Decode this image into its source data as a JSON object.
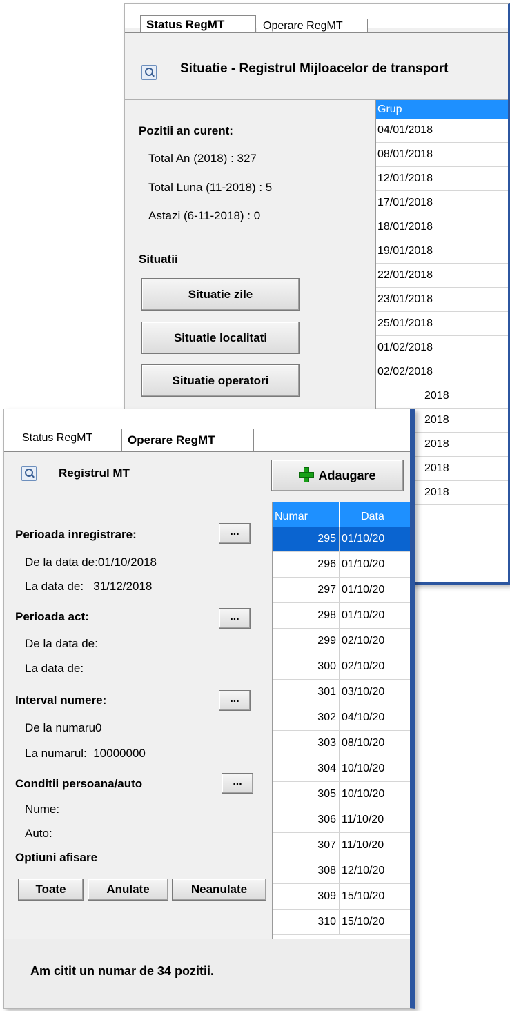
{
  "back_window": {
    "tabs": [
      "Status RegMT",
      "Operare RegMT"
    ],
    "title": "Situatie - Registrul Mijloacelor de transport",
    "section_positions": "Pozitii an curent:",
    "total_an": "Total An (2018) : 327",
    "total_luna": "Total Luna (11-2018) : 5",
    "astazi": "Astazi (6-11-2018) : 0",
    "section_reports": "Situatii",
    "btn_zile": "Situatie zile",
    "btn_localitati": "Situatie localitati",
    "btn_operatori": "Situatie operatori",
    "grid_header": "Grup",
    "grid_rows": [
      "04/01/2018",
      "08/01/2018",
      "12/01/2018",
      "17/01/2018",
      "18/01/2018",
      "19/01/2018",
      "22/01/2018",
      "23/01/2018",
      "25/01/2018",
      "01/02/2018",
      "02/02/2018",
      "2018",
      "2018",
      "2018",
      "2018",
      "2018"
    ]
  },
  "front_window": {
    "tabs": [
      "Status RegMT",
      "Operare RegMT"
    ],
    "title": "Registrul MT",
    "add_button": "Adaugare",
    "perioada_inregistrare": "Perioada inregistrare:",
    "de_la_data_1": "De la data de:01/10/2018",
    "la_data_1": "La data de:   31/12/2018",
    "perioada_act": "Perioada act:",
    "de_la_data_2": "De la data de:",
    "la_data_2": "La data de:",
    "interval_numere": "Interval numere:",
    "de_la_numar": "De la numaru0",
    "la_numar": "La numarul:  10000000",
    "conditii": "Conditii persoana/auto",
    "nume": "Nume:",
    "auto": "Auto:",
    "optiuni": "Optiuni afisare",
    "btn_toate": "Toate",
    "btn_anulate": "Anulate",
    "btn_neanulate": "Neanulate",
    "dots": "...",
    "grid_headers": [
      "Numar",
      "Data"
    ],
    "grid_rows": [
      {
        "num": "295",
        "date": "01/10/20"
      },
      {
        "num": "296",
        "date": "01/10/20"
      },
      {
        "num": "297",
        "date": "01/10/20"
      },
      {
        "num": "298",
        "date": "01/10/20"
      },
      {
        "num": "299",
        "date": "02/10/20"
      },
      {
        "num": "300",
        "date": "02/10/20"
      },
      {
        "num": "301",
        "date": "03/10/20"
      },
      {
        "num": "302",
        "date": "04/10/20"
      },
      {
        "num": "303",
        "date": "08/10/20"
      },
      {
        "num": "304",
        "date": "10/10/20"
      },
      {
        "num": "305",
        "date": "10/10/20"
      },
      {
        "num": "306",
        "date": "11/10/20"
      },
      {
        "num": "307",
        "date": "11/10/20"
      },
      {
        "num": "308",
        "date": "12/10/20"
      },
      {
        "num": "309",
        "date": "15/10/20"
      },
      {
        "num": "310",
        "date": "15/10/20"
      }
    ],
    "status": "Am citit un numar de 34 pozitii."
  }
}
